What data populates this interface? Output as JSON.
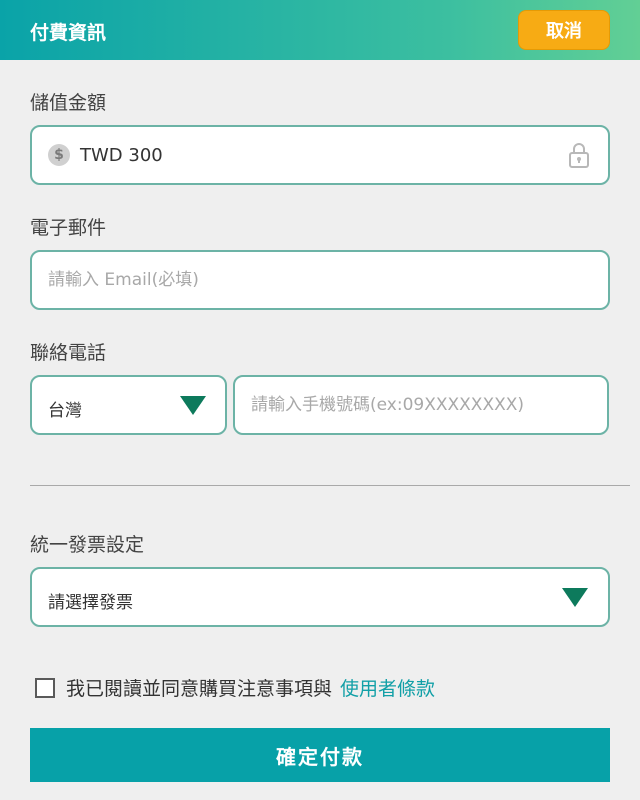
{
  "header": {
    "title": "付費資訊",
    "cancel_label": "取消"
  },
  "amount": {
    "label": "儲值金額",
    "currency_icon": "dollar-coin-icon",
    "value": "TWD 300",
    "lock_icon": "lock-icon"
  },
  "email": {
    "label": "電子郵件",
    "placeholder": "請輸入 Email(必填)",
    "value": ""
  },
  "phone": {
    "label": "聯絡電話",
    "country": "台灣",
    "placeholder": "請輸入手機號碼(ex:09XXXXXXXX)",
    "value": ""
  },
  "invoice": {
    "label": "統一發票設定",
    "selected": "請選擇發票"
  },
  "agreement": {
    "text": "我已閱讀並同意購買注意事項與",
    "link_text": "使用者條款",
    "checked": false
  },
  "confirm_label": "確定付款",
  "colors": {
    "header_start": "#0aa3a8",
    "header_end": "#62cf95",
    "cancel_bg": "#f7ab14",
    "field_border": "#6cb3a6",
    "accent": "#07a1a8",
    "dropdown_arrow": "#0d7a5c"
  }
}
